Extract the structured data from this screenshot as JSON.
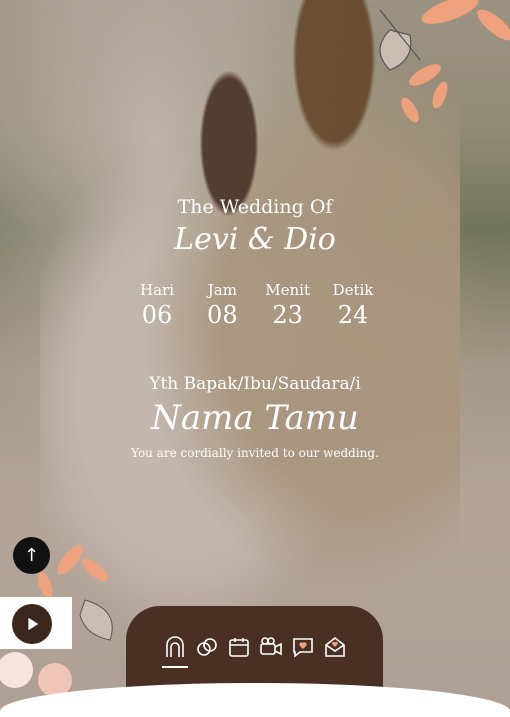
{
  "hero": {
    "subtitle": "The Wedding Of",
    "couple": "Levi & Dio"
  },
  "countdown": [
    {
      "label": "Hari",
      "value": "06"
    },
    {
      "label": "Jam",
      "value": "08"
    },
    {
      "label": "Menit",
      "value": "23"
    },
    {
      "label": "Detik",
      "value": "24"
    }
  ],
  "guest": {
    "salutation": "Yth Bapak/Ibu/Saudara/i",
    "name": "Nama Tamu",
    "invitation": "You are cordially invited to our wedding."
  },
  "controls": {
    "scroll_top_icon": "arrow-up-icon",
    "music_icon": "play-icon"
  },
  "nav": [
    {
      "icon": "arch-icon",
      "active": true
    },
    {
      "icon": "rings-icon",
      "active": false
    },
    {
      "icon": "calendar-icon",
      "active": false
    },
    {
      "icon": "camera-icon",
      "active": false
    },
    {
      "icon": "chat-heart-icon",
      "active": false
    },
    {
      "icon": "envelope-heart-icon",
      "active": false
    }
  ],
  "colors": {
    "accent": "#4a3022",
    "text": "#ffffff",
    "flower": "#f0a07a"
  }
}
